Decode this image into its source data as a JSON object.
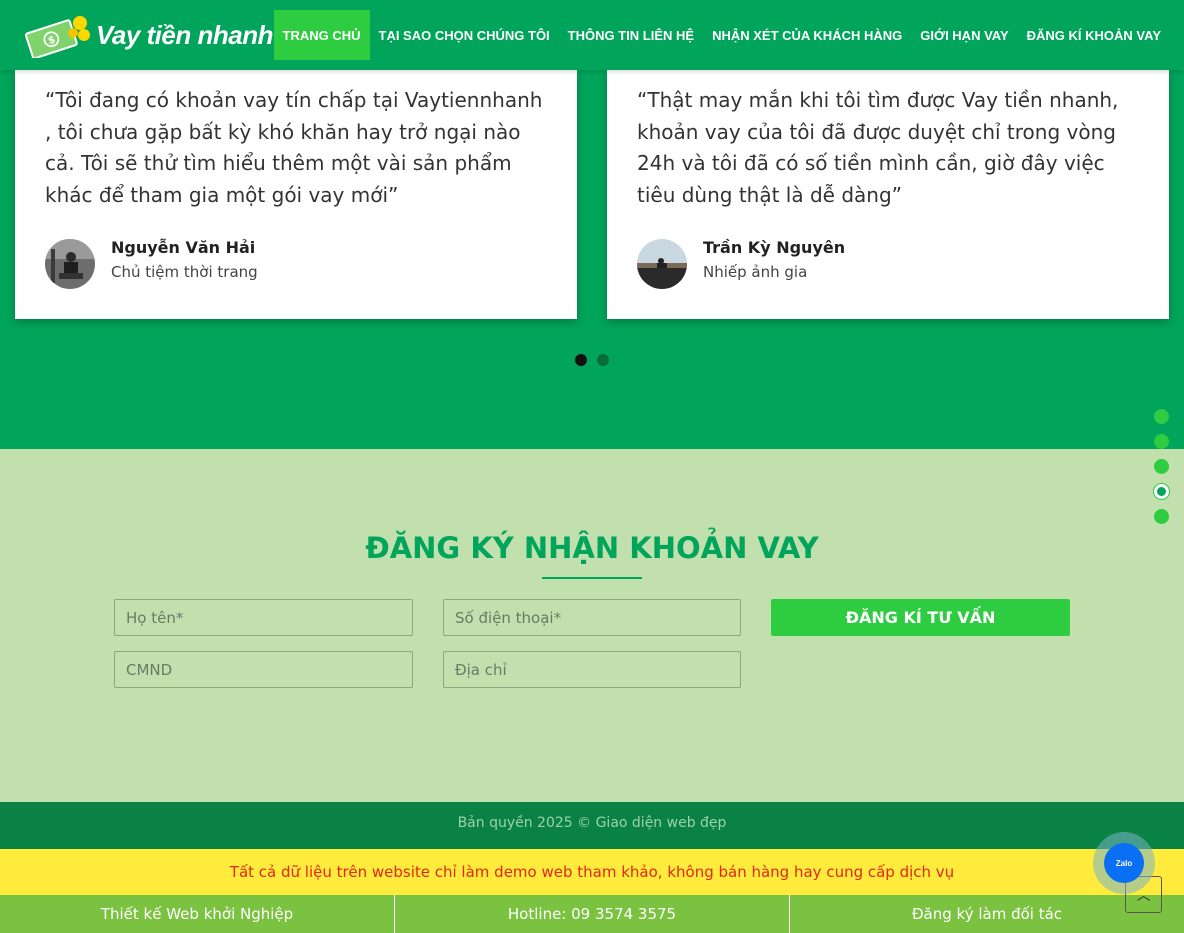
{
  "brand": {
    "name": "Vay tiền nhanh"
  },
  "nav": [
    {
      "label": "TRANG CHỦ",
      "active": true
    },
    {
      "label": "TẠI SAO CHỌN CHÚNG TÔI",
      "active": false
    },
    {
      "label": "THÔNG TIN LIÊN HỆ",
      "active": false
    },
    {
      "label": "NHẬN XÉT CỦA KHÁCH HÀNG",
      "active": false
    },
    {
      "label": "GIỚI HẠN VAY",
      "active": false
    },
    {
      "label": "ĐĂNG KÍ KHOẢN VAY",
      "active": false
    }
  ],
  "testimonials": [
    {
      "quote": "“Tôi đang có khoản vay tín chấp tại Vaytiennhanh , tôi chưa gặp bất kỳ khó khăn hay trở ngại nào cả. Tôi sẽ thử tìm hiểu thêm một vài sản phẩm khác để tham gia một gói vay mới”",
      "name": "Nguyễn Văn Hải",
      "role": "Chủ tiệm thời trang"
    },
    {
      "quote": "“Thật may mắn khi tôi tìm được Vay tiền nhanh, khoản vay của tôi đã được duyệt chỉ trong vòng 24h và tôi đã có số tiền mình cần, giờ đây việc tiêu dùng thật là dễ dàng”",
      "name": "Trần Kỳ Nguyên",
      "role": "Nhiếp ảnh gia"
    }
  ],
  "register": {
    "title": "ĐĂNG KÝ NHẬN KHOẢN VAY",
    "name_placeholder": "Họ tên*",
    "phone_placeholder": "Số điện thoại*",
    "id_placeholder": "CMND",
    "address_placeholder": "Địa chỉ",
    "submit_label": "ĐĂNG KÍ TƯ VẤN"
  },
  "footer": {
    "copyright": "Bản quyền 2025 © Giao diện web đẹp",
    "notice": "Tất cả dữ liệu trên website chỉ làm demo web tham khảo, không bán hàng hay cung cấp dịch vụ",
    "bottom_links": [
      "Thiết kế Web khởi Nghiệp",
      "Hotline: 09 3574 3575",
      "Đăng ký làm đối tác"
    ]
  },
  "zalo": {
    "label": "Zalo"
  },
  "colors": {
    "primary": "#00a45a",
    "accent": "#2ecc40",
    "light": "#c2e0ad",
    "notice_bg": "#ffeb3b",
    "notice_text": "#e0281b"
  }
}
